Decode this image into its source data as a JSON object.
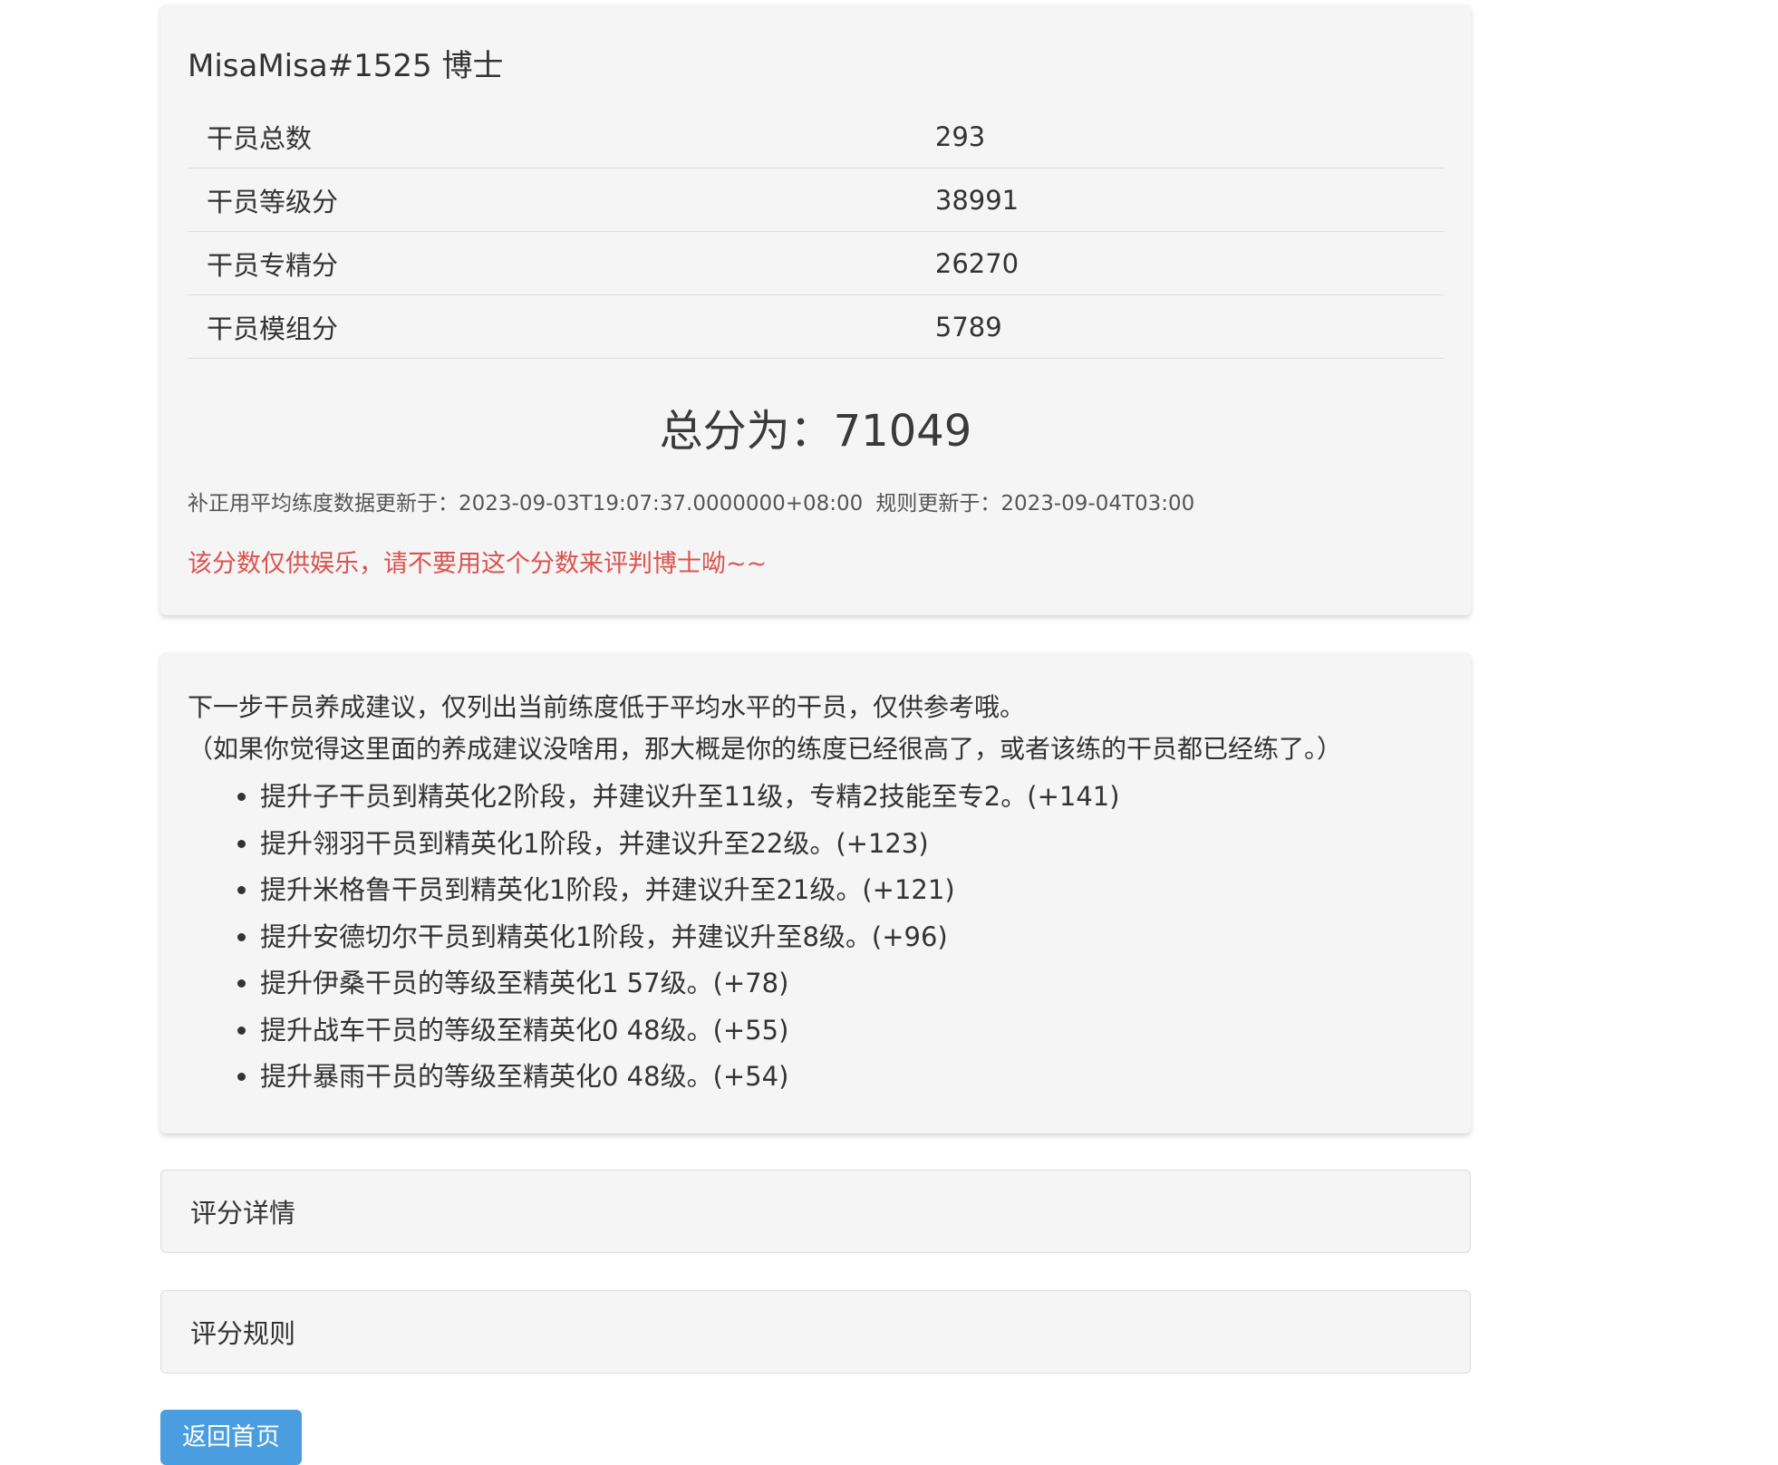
{
  "summary": {
    "title": "MisaMisa#1525 博士",
    "stats": [
      {
        "label": "干员总数",
        "value": "293"
      },
      {
        "label": "干员等级分",
        "value": "38991"
      },
      {
        "label": "干员专精分",
        "value": "26270"
      },
      {
        "label": "干员模组分",
        "value": "5789"
      }
    ],
    "total": "总分为：71049",
    "data_updated": "补正用平均练度数据更新于：2023-09-03T19:07:37.0000000+08:00",
    "rules_updated": "规则更新于：2023-09-04T03:00",
    "disclaimer": "该分数仅供娱乐，请不要用这个分数来评判博士呦~~"
  },
  "advice": {
    "intro": "下一步干员养成建议，仅列出当前练度低于平均水平的干员，仅供参考哦。",
    "note": "（如果你觉得这里面的养成建议没啥用，那大概是你的练度已经很高了，或者该练的干员都已经练了。）",
    "items": [
      "提升子干员到精英化2阶段，并建议升至11级，专精2技能至专2。(+141)",
      "提升翎羽干员到精英化1阶段，并建议升至22级。(+123)",
      "提升米格鲁干员到精英化1阶段，并建议升至21级。(+121)",
      "提升安德切尔干员到精英化1阶段，并建议升至8级。(+96)",
      "提升伊桑干员的等级至精英化1 57级。(+78)",
      "提升战车干员的等级至精英化0 48级。(+55)",
      "提升暴雨干员的等级至精英化0 48级。(+54)"
    ]
  },
  "sections": {
    "details": "评分详情",
    "rules": "评分规则"
  },
  "home_button": "返回首页"
}
